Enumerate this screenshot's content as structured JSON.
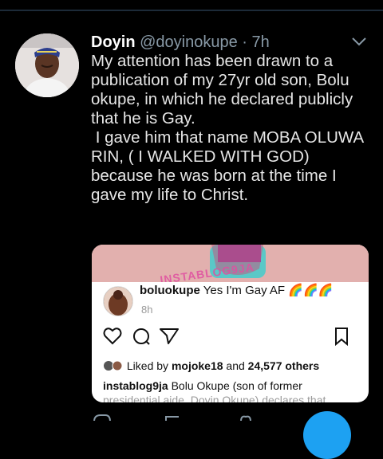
{
  "tweet": {
    "author_name": "Doyin",
    "author_handle": "@doyinokupe",
    "timestamp": "7h",
    "separator": "·",
    "text": "My attention has been drawn to a publication of my 27yr old son, Bolu okupe, in which he declared publicly that he is Gay.\n I gave him that name MOBA OLUWA RIN, ( I WALKED WITH GOD) because he was born at the time I gave my life to Christ."
  },
  "embed": {
    "watermark": "INSTABLOG9JA",
    "username": "boluokupe",
    "post_text": "Yes I'm Gay AF",
    "emojis": "🌈🌈🌈",
    "time": "8h",
    "liked_by_prefix": "Liked by",
    "liked_by_user": "mojoke18",
    "liked_by_and": "and",
    "likes_count": "24,577 others",
    "caption_user": "instablog9ja",
    "caption_text": "Bolu Okupe (son of former",
    "caption_more": "presidential aide, Doyin Okupe) declares that"
  },
  "colors": {
    "background": "#000000",
    "handle": "#8899a6",
    "accent": "#1da1f2"
  },
  "icons": [
    "chevron-down-icon",
    "heart-icon",
    "comment-icon",
    "share-icon",
    "bookmark-icon"
  ]
}
